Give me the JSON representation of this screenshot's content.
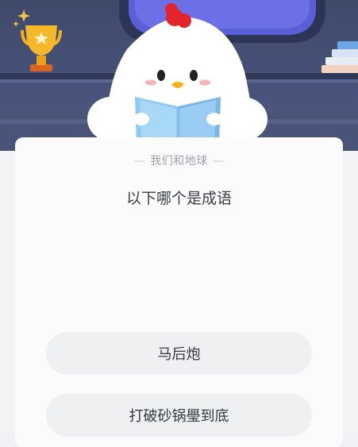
{
  "quiz": {
    "category": "我们和地球",
    "question": "以下哪个是成语",
    "options": [
      {
        "label": "马后炮"
      },
      {
        "label": "打破砂锅璺到底"
      }
    ]
  },
  "colors": {
    "background_scene": "#47527a",
    "card": "#fbfbfc",
    "option_bg": "#eef0f2",
    "chick_comb": "#e3242b",
    "book": "#8fc9f0",
    "trophy": "#f2b01e"
  },
  "icons": [
    "trophy-icon",
    "star-icon",
    "sparkle-icon",
    "books-icon",
    "chick-mascot"
  ]
}
